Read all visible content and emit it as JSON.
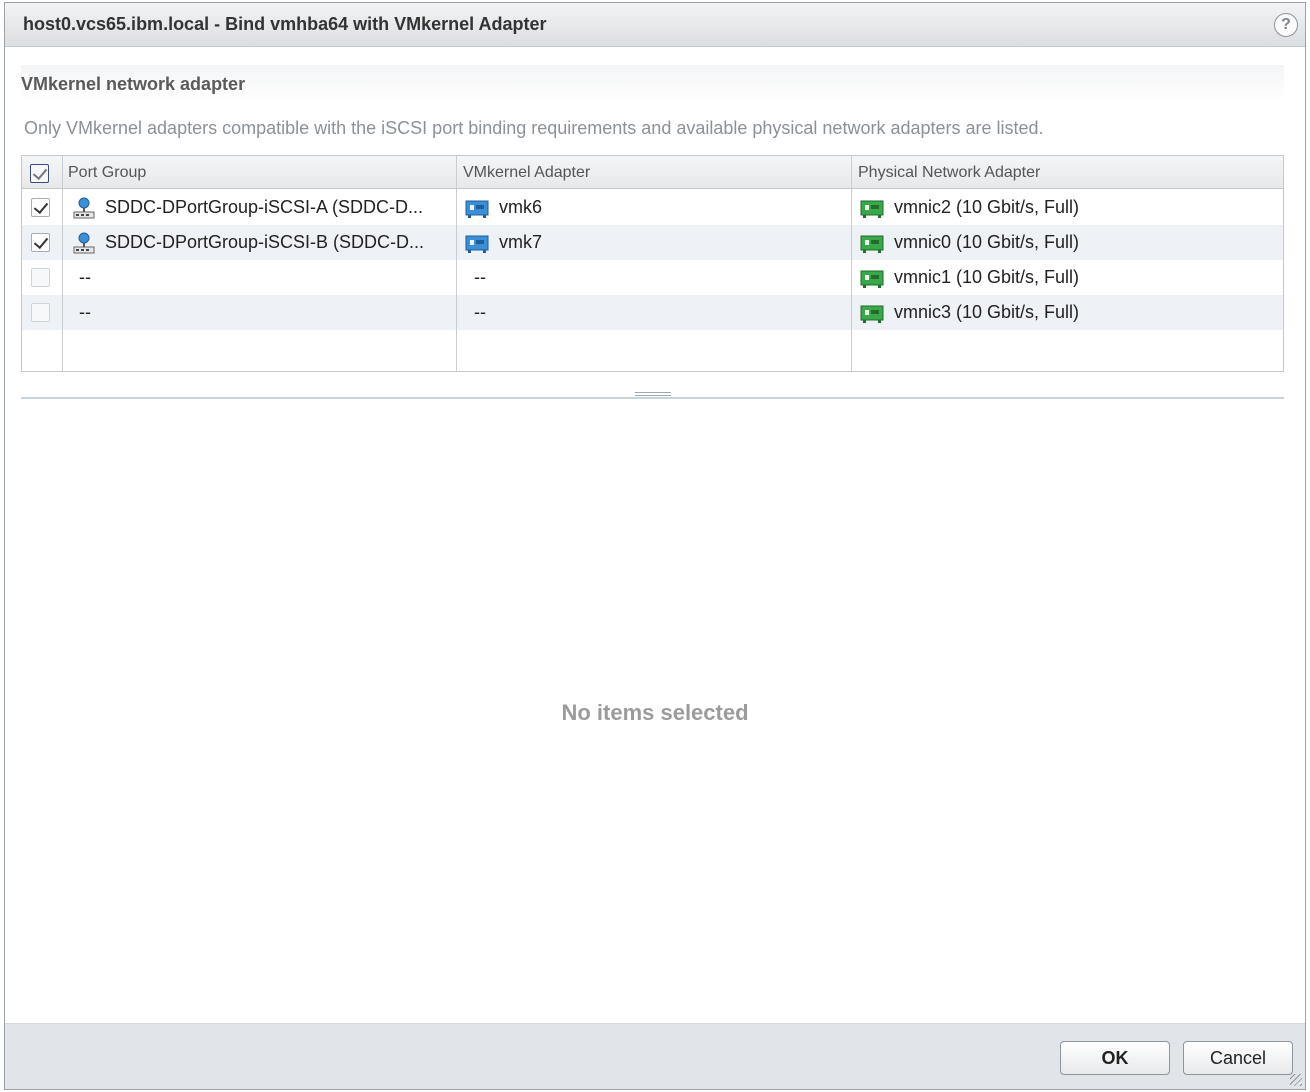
{
  "dialog": {
    "title": "host0.vcs65.ibm.local - Bind vmhba64 with VMkernel Adapter",
    "help_label": "?"
  },
  "section": {
    "title": "VMkernel network adapter",
    "info": "Only VMkernel adapters compatible with the iSCSI port binding requirements and available physical network adapters are listed."
  },
  "table": {
    "headers": [
      "Port Group",
      "VMkernel Adapter",
      "Physical Network Adapter"
    ],
    "rows": [
      {
        "checked": true,
        "port_group": "SDDC-DPortGroup-iSCSI-A (SDDC-D...",
        "vmk": "vmk6",
        "pnic": "vmnic2 (10 Gbit/s, Full)"
      },
      {
        "checked": true,
        "port_group": "SDDC-DPortGroup-iSCSI-B (SDDC-D...",
        "vmk": "vmk7",
        "pnic": "vmnic0 (10 Gbit/s, Full)"
      },
      {
        "checked": false,
        "port_group": "--",
        "vmk": "--",
        "pnic": "vmnic1 (10 Gbit/s, Full)"
      },
      {
        "checked": false,
        "port_group": "--",
        "vmk": "--",
        "pnic": "vmnic3 (10 Gbit/s, Full)"
      }
    ]
  },
  "details": {
    "empty_text": "No items selected"
  },
  "footer": {
    "ok_label": "OK",
    "cancel_label": "Cancel"
  },
  "icons": {
    "port_group": "distributed-port-group-icon",
    "vmk": "vmkernel-adapter-icon",
    "pnic": "physical-nic-icon"
  },
  "colors": {
    "vmk_icon": "#3a8fd6",
    "pnic_icon": "#3aa84a"
  }
}
